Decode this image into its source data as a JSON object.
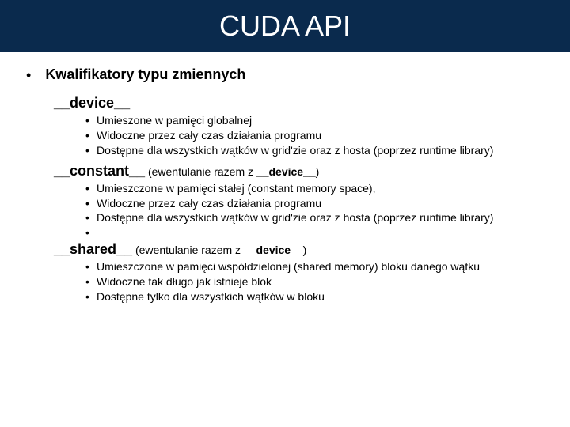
{
  "title": "CUDA API",
  "main_heading": "Kwalifikatory typu zmiennych",
  "sections": [
    {
      "title": "__device__",
      "paren_before": "",
      "paren_bold": "",
      "paren_after": "",
      "items": [
        "Umieszone w pamięci globalnej",
        "Widoczne przez cały czas działania programu",
        "Dostępne dla wszystkich wątków w grid'zie oraz z hosta (poprzez runtime library)"
      ],
      "trailing_empty": false
    },
    {
      "title": "__constant__",
      "paren_before": " (ewentulanie razem z ",
      "paren_bold": "__device__",
      "paren_after": ")",
      "items": [
        "Umieszczone w pamięci stałej (constant memory space),",
        "Widoczne przez cały czas działania programu",
        "Dostępne dla wszystkich wątków w grid'zie oraz z hosta (poprzez runtime library)"
      ],
      "trailing_empty": true
    },
    {
      "title": "__shared__",
      "paren_before": " (ewentulanie razem z ",
      "paren_bold": "__device__",
      "paren_after": ")",
      "items": [
        "Umieszczone w pamięci współdzielonej (shared memory) bloku danego wątku",
        "Widoczne tak długo jak istnieje blok",
        "Dostępne tylko dla wszystkich wątków w bloku"
      ],
      "trailing_empty": false
    }
  ]
}
